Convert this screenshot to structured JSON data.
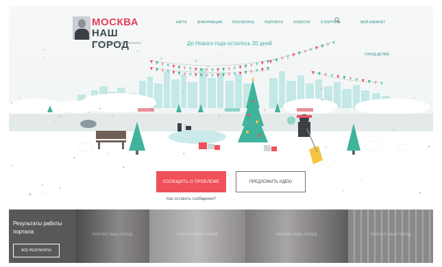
{
  "header": {
    "logo": {
      "line1": "МОСКВА",
      "line2": "НАШ ГОРОД",
      "subtitle": "ПОРТАЛ МЭРА МОСКВЫ СОБЯНИНА С.С."
    },
    "nav": [
      "КАРТА",
      "ИНФОРМАЦИЯ",
      "РЕЗУЛЬТАТЫ",
      "РЕЙТИНГИ",
      "НОВОСТИ",
      "О ПОРТАЛЕ"
    ],
    "search_icon": "search-icon",
    "cabinet": "МОЙ КАБИНЕТ"
  },
  "hero": {
    "countdown": "До Нового года осталось 20 дней",
    "kids_link": "ГОРОД ДЕТЯМ",
    "buttons": {
      "report": "СООБЩИТЬ О ПРОБЛЕМЕ",
      "idea": "ПРЕДЛОЖИТЬ ИДЕЮ"
    },
    "how_link": "Как оставить сообщение?"
  },
  "results": {
    "title": "Результаты работы портала",
    "all_button": "ВСЕ РЕЗУЛЬТАТЫ",
    "watermark": "ПОРТАЛ НАШ ГОРОД"
  },
  "colors": {
    "accent_red": "#f0505a",
    "accent_teal": "#2e8f86",
    "tree_green": "#3fb39b"
  }
}
